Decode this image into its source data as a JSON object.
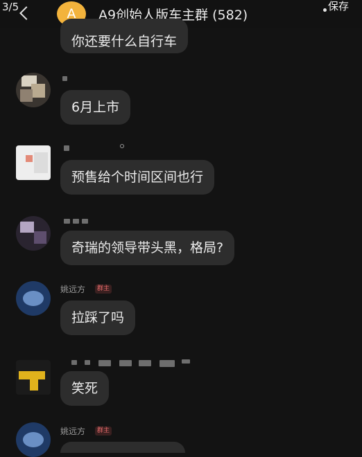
{
  "header": {
    "page_counter": "3/5",
    "group_avatar_letter": "A",
    "group_title": "A9创始人版车主群 (582)",
    "save_label": "保存"
  },
  "messages": [
    {
      "text": "你还要什么自行车"
    },
    {
      "text": "6月上市"
    },
    {
      "text": "预售给个时间区间也行"
    },
    {
      "text": "奇瑞的领导带头黑，格局?"
    },
    {
      "sender": "姚远方",
      "role": "群主",
      "text": "拉踩了吗"
    },
    {
      "text": "笑死"
    },
    {
      "sender": "姚远方",
      "role": "群主"
    }
  ],
  "colors": {
    "background": "#131313",
    "bubble": "#2d2d2d",
    "group_avatar": "#f3b33c",
    "role_badge": "#e46a6a"
  }
}
